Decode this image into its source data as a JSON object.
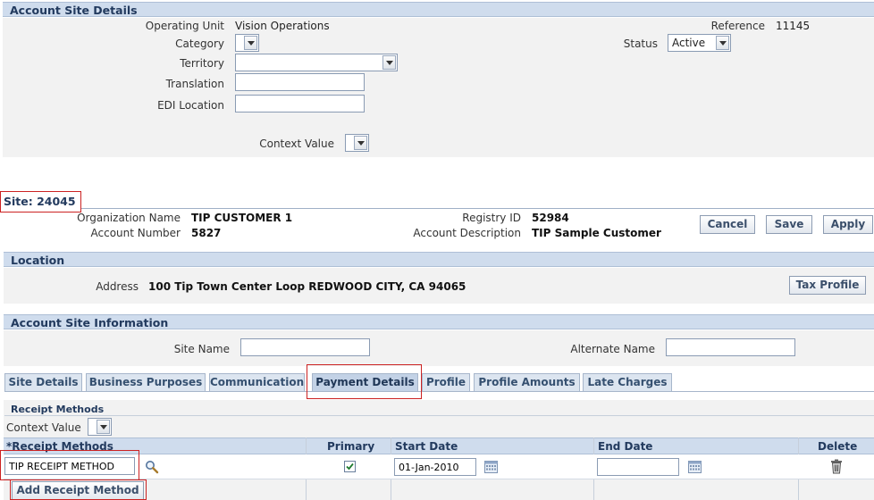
{
  "account_site_details": {
    "header": "Account Site Details",
    "operating_unit_label": "Operating Unit",
    "operating_unit_value": "Vision Operations",
    "category_label": "Category",
    "territory_label": "Territory",
    "translation_label": "Translation",
    "edi_location_label": "EDI Location",
    "context_value_label": "Context Value",
    "reference_label": "Reference",
    "reference_value": "11145",
    "status_label": "Status",
    "status_value": "Active"
  },
  "site": {
    "title": "Site: 24045",
    "org_name_label": "Organization Name",
    "org_name_value": "TIP CUSTOMER 1",
    "account_number_label": "Account Number",
    "account_number_value": "5827",
    "registry_id_label": "Registry ID",
    "registry_id_value": "52984",
    "account_desc_label": "Account Description",
    "account_desc_value": "TIP Sample Customer",
    "cancel": "Cancel",
    "save": "Save",
    "apply": "Apply"
  },
  "location": {
    "header": "Location",
    "address_label": "Address",
    "address_value": "100 Tip Town Center Loop REDWOOD CITY, CA 94065",
    "tax_profile": "Tax Profile"
  },
  "account_site_info": {
    "header": "Account Site Information",
    "site_name_label": "Site Name",
    "alternate_name_label": "Alternate Name"
  },
  "tabs": [
    {
      "label": "Site Details"
    },
    {
      "label": "Business Purposes"
    },
    {
      "label": "Communication"
    },
    {
      "label": "Payment Details"
    },
    {
      "label": "Profile"
    },
    {
      "label": "Profile Amounts"
    },
    {
      "label": "Late Charges"
    }
  ],
  "receipt_methods": {
    "section_title": "Receipt Methods",
    "context_value_label": "Context Value",
    "columns": {
      "receipt_methods": "*Receipt Methods",
      "primary": "Primary",
      "start_date": "Start Date",
      "end_date": "End Date",
      "delete": "Delete"
    },
    "row": {
      "method": "TIP RECEIPT METHOD",
      "start_date": "01-Jan-2010"
    },
    "add_button": "Add Receipt Method"
  }
}
